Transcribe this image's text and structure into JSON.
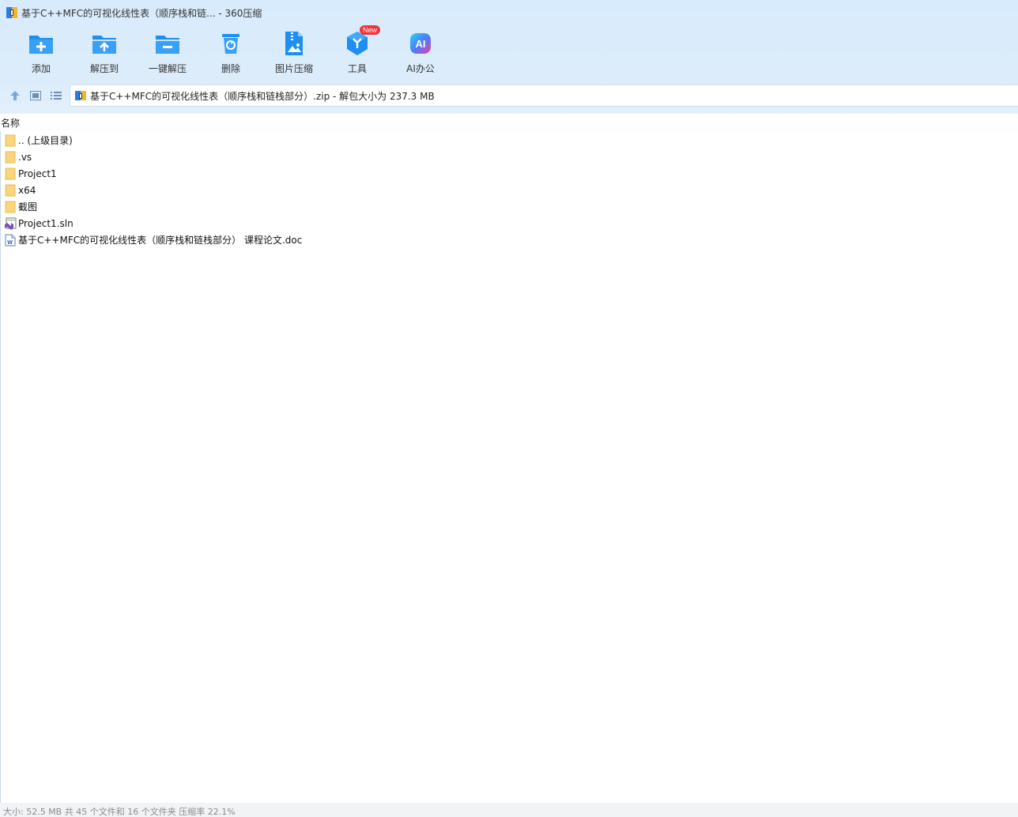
{
  "window": {
    "title": "基于C++MFC的可视化线性表（顺序栈和链... - 360压缩"
  },
  "toolbar": {
    "items": [
      {
        "label": "添加",
        "icon": "add-folder-icon"
      },
      {
        "label": "解压到",
        "icon": "extract-to-icon"
      },
      {
        "label": "一键解压",
        "icon": "one-click-extract-icon"
      },
      {
        "label": "删除",
        "icon": "recycle-bin-icon"
      },
      {
        "label": "图片压缩",
        "icon": "image-compress-icon"
      },
      {
        "label": "工具",
        "icon": "tools-cube-icon",
        "badge": "New"
      },
      {
        "label": "AI办公",
        "icon": "ai-office-icon",
        "icon_text": "AI"
      }
    ]
  },
  "address": {
    "path": "基于C++MFC的可视化线性表（顺序栈和链栈部分）.zip - 解包大小为 237.3 MB"
  },
  "columns": {
    "name": "名称"
  },
  "files": [
    {
      "name": ".. (上级目录)",
      "type": "folder"
    },
    {
      "name": ".vs",
      "type": "folder"
    },
    {
      "name": "Project1",
      "type": "folder"
    },
    {
      "name": "x64",
      "type": "folder"
    },
    {
      "name": "截图",
      "type": "folder"
    },
    {
      "name": "Project1.sln",
      "type": "sln"
    },
    {
      "name": "基于C++MFC的可视化线性表（顺序栈和链栈部分） 课程论文.doc",
      "type": "doc"
    }
  ],
  "status": {
    "text": "大小: 52.5 MB 共 45 个文件和 16 个文件夹 压缩率 22.1%"
  },
  "colors": {
    "toolbar_blue": "#1d8ff2",
    "badge_red": "#f2343a",
    "folder_yellow": "#f9d67a"
  }
}
